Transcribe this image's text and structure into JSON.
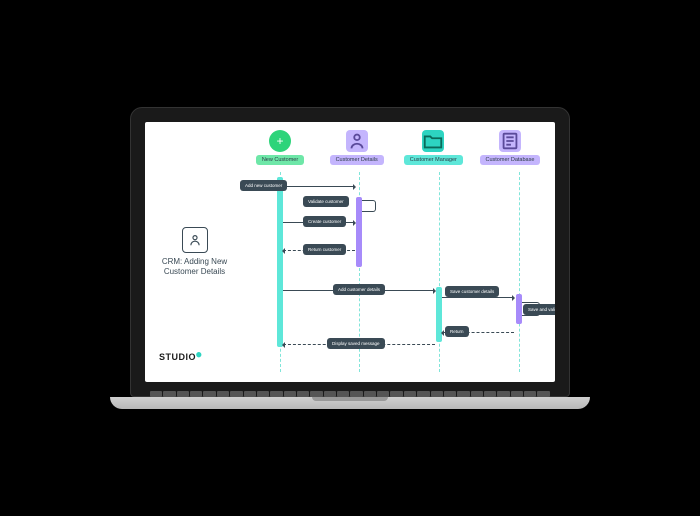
{
  "diagram": {
    "title": "CRM: Adding New Customer Details",
    "lanes": [
      {
        "label": "New Customer",
        "icon": "plus-icon"
      },
      {
        "label": "Customer Details",
        "icon": "person-icon"
      },
      {
        "label": "Customer Manager",
        "icon": "folder-icon"
      },
      {
        "label": "Customer Database",
        "icon": "list-icon"
      }
    ],
    "messages": {
      "add_new": "Add new customer",
      "validate": "Validate customer",
      "create": "Create customer",
      "return_cust": "Return customer",
      "add_details": "Add customer details",
      "save_details": "Save customer details",
      "save_validate": "Save and validate",
      "return": "Return",
      "display": "Display saved message"
    }
  },
  "brand": "STUDIO"
}
